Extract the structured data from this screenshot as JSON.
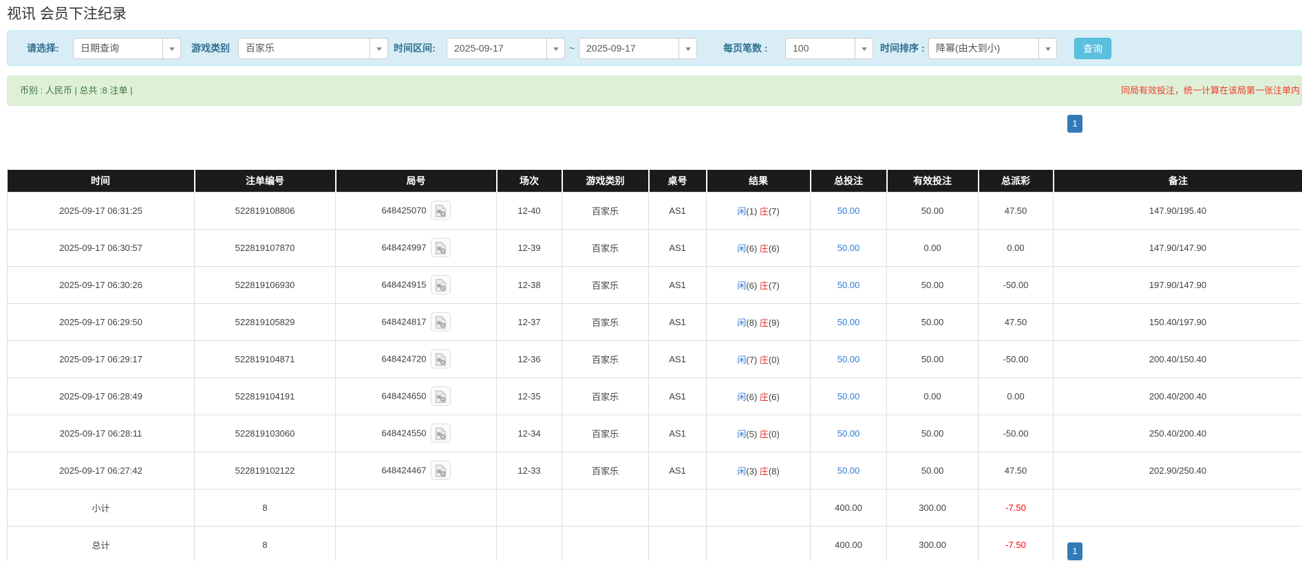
{
  "page_title": "视讯 会员下注纪录",
  "filter_bar": {
    "select_label": "请选择:",
    "select_value": "日期查询",
    "game_label": "游戏类别",
    "game_value": "百家乐",
    "range_label": "时间区间:",
    "date_from": "2025-09-17",
    "tilde": "~",
    "date_to": "2025-09-17",
    "page_size_label": "每页笔数 :",
    "page_size_value": "100",
    "sort_label": "时间排序 :",
    "sort_value": "降幂(由大到小)",
    "search_button_label": "查询"
  },
  "summary_bar": {
    "currency_text": "币别 : 人民币 | 总共 :8 注单 |",
    "notice_text": "同局有效投注，统一计算在该局第一张注单内"
  },
  "pagination": {
    "current_page": "1"
  },
  "table": {
    "headers": [
      "时间",
      "注单编号",
      "局号",
      "场次",
      "游戏类别",
      "桌号",
      "结果",
      "总投注",
      "有效投注",
      "总派彩",
      "备注"
    ],
    "rows": [
      {
        "time": "2025-09-17 06:31:25",
        "bet_id": "522819108806",
        "round_id": "648425070",
        "session": "12-40",
        "game": "百家乐",
        "table_no": "AS1",
        "result": {
          "player": "闲",
          "player_score": "(1)",
          "banker": "庄",
          "banker_score": "(7)"
        },
        "total_bet": "50.00",
        "valid_bet": "50.00",
        "payout": "47.50",
        "remark": "147.90/195.40"
      },
      {
        "time": "2025-09-17 06:30:57",
        "bet_id": "522819107870",
        "round_id": "648424997",
        "session": "12-39",
        "game": "百家乐",
        "table_no": "AS1",
        "result": {
          "player": "闲",
          "player_score": "(6)",
          "banker": "庄",
          "banker_score": "(6)"
        },
        "total_bet": "50.00",
        "valid_bet": "0.00",
        "payout": "0.00",
        "remark": "147.90/147.90"
      },
      {
        "time": "2025-09-17 06:30:26",
        "bet_id": "522819106930",
        "round_id": "648424915",
        "session": "12-38",
        "game": "百家乐",
        "table_no": "AS1",
        "result": {
          "player": "闲",
          "player_score": "(6)",
          "banker": "庄",
          "banker_score": "(7)"
        },
        "total_bet": "50.00",
        "valid_bet": "50.00",
        "payout": "-50.00",
        "remark": "197.90/147.90"
      },
      {
        "time": "2025-09-17 06:29:50",
        "bet_id": "522819105829",
        "round_id": "648424817",
        "session": "12-37",
        "game": "百家乐",
        "table_no": "AS1",
        "result": {
          "player": "闲",
          "player_score": "(8)",
          "banker": "庄",
          "banker_score": "(9)"
        },
        "total_bet": "50.00",
        "valid_bet": "50.00",
        "payout": "47.50",
        "remark": "150.40/197.90"
      },
      {
        "time": "2025-09-17 06:29:17",
        "bet_id": "522819104871",
        "round_id": "648424720",
        "session": "12-36",
        "game": "百家乐",
        "table_no": "AS1",
        "result": {
          "player": "闲",
          "player_score": "(7)",
          "banker": "庄",
          "banker_score": "(0)"
        },
        "total_bet": "50.00",
        "valid_bet": "50.00",
        "payout": "-50.00",
        "remark": "200.40/150.40"
      },
      {
        "time": "2025-09-17 06:28:49",
        "bet_id": "522819104191",
        "round_id": "648424650",
        "session": "12-35",
        "game": "百家乐",
        "table_no": "AS1",
        "result": {
          "player": "闲",
          "player_score": "(6)",
          "banker": "庄",
          "banker_score": "(6)"
        },
        "total_bet": "50.00",
        "valid_bet": "0.00",
        "payout": "0.00",
        "remark": "200.40/200.40"
      },
      {
        "time": "2025-09-17 06:28:11",
        "bet_id": "522819103060",
        "round_id": "648424550",
        "session": "12-34",
        "game": "百家乐",
        "table_no": "AS1",
        "result": {
          "player": "闲",
          "player_score": "(5)",
          "banker": "庄",
          "banker_score": "(0)"
        },
        "total_bet": "50.00",
        "valid_bet": "50.00",
        "payout": "-50.00",
        "remark": "250.40/200.40"
      },
      {
        "time": "2025-09-17 06:27:42",
        "bet_id": "522819102122",
        "round_id": "648424467",
        "session": "12-33",
        "game": "百家乐",
        "table_no": "AS1",
        "result": {
          "player": "闲",
          "player_score": "(3)",
          "banker": "庄",
          "banker_score": "(8)"
        },
        "total_bet": "50.00",
        "valid_bet": "50.00",
        "payout": "47.50",
        "remark": "202.90/250.40"
      }
    ],
    "subtotal": {
      "label": "小计",
      "count": "8",
      "total_bet": "400.00",
      "valid_bet": "300.00",
      "payout": "-7.50"
    },
    "grand_total": {
      "label": "总计",
      "count": "8",
      "total_bet": "400.00",
      "valid_bet": "300.00",
      "payout": "-7.50"
    }
  },
  "colors": {
    "accent_blue": "#2b7bd6",
    "player_blue": "#2b7bd6",
    "banker_red": "#e03333",
    "negative_red": "#ff0000",
    "header_bg": "#1b1b1b",
    "filter_bar_bg": "#d9edf7",
    "summary_bar_bg": "#dff0d8",
    "summary_text_green": "#3c763d",
    "notice_red": "#ee3b28",
    "search_button_blue": "#5bc0de",
    "pagination_blue": "#337ab7",
    "total_row_gray": "#9c9c9c"
  }
}
